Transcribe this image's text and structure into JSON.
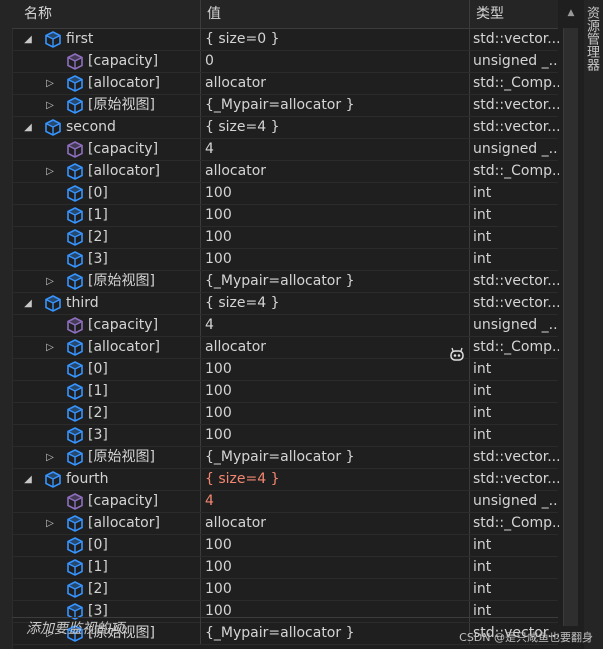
{
  "header": {
    "name": "名称",
    "value": "值",
    "type": "类型"
  },
  "right_rail": {
    "label": "资源管理器"
  },
  "add_watch": {
    "label": "添加要监视的项"
  },
  "watermark": {
    "text": "CSDN @是只咸鱼也要翻身"
  },
  "colors": {
    "changed_value": "#f48771",
    "cube_icon": "#3794ff",
    "capacity_icon": "#8e6fbf"
  },
  "rows": [
    {
      "level": 0,
      "expand": "expanded",
      "icon": "cube",
      "name": "first",
      "value": "{ size=0 }",
      "type": "std::vector...."
    },
    {
      "level": 1,
      "expand": "none",
      "icon": "capacity",
      "name": "[capacity]",
      "value": "0",
      "type": "unsigned _..."
    },
    {
      "level": 1,
      "expand": "collapsed",
      "icon": "cube",
      "name": "[allocator]",
      "value": "allocator",
      "type": "std::_Comp..."
    },
    {
      "level": 1,
      "expand": "collapsed",
      "icon": "cube",
      "name": "[原始视图]",
      "value": "{_Mypair=allocator }",
      "type": "std::vector...."
    },
    {
      "level": 0,
      "expand": "expanded",
      "icon": "cube",
      "name": "second",
      "value": "{ size=4 }",
      "type": "std::vector...."
    },
    {
      "level": 1,
      "expand": "none",
      "icon": "capacity",
      "name": "[capacity]",
      "value": "4",
      "type": "unsigned _..."
    },
    {
      "level": 1,
      "expand": "collapsed",
      "icon": "cube",
      "name": "[allocator]",
      "value": "allocator",
      "type": "std::_Comp..."
    },
    {
      "level": 1,
      "expand": "none",
      "icon": "cube",
      "name": "[0]",
      "value": "100",
      "type": "int"
    },
    {
      "level": 1,
      "expand": "none",
      "icon": "cube",
      "name": "[1]",
      "value": "100",
      "type": "int"
    },
    {
      "level": 1,
      "expand": "none",
      "icon": "cube",
      "name": "[2]",
      "value": "100",
      "type": "int"
    },
    {
      "level": 1,
      "expand": "none",
      "icon": "cube",
      "name": "[3]",
      "value": "100",
      "type": "int"
    },
    {
      "level": 1,
      "expand": "collapsed",
      "icon": "cube",
      "name": "[原始视图]",
      "value": "{_Mypair=allocator }",
      "type": "std::vector...."
    },
    {
      "level": 0,
      "expand": "expanded",
      "icon": "cube",
      "name": "third",
      "value": "{ size=4 }",
      "type": "std::vector...."
    },
    {
      "level": 1,
      "expand": "none",
      "icon": "capacity",
      "name": "[capacity]",
      "value": "4",
      "type": "unsigned _..."
    },
    {
      "level": 1,
      "expand": "collapsed",
      "icon": "cube",
      "name": "[allocator]",
      "value": "allocator",
      "type": "std::_Comp..."
    },
    {
      "level": 1,
      "expand": "none",
      "icon": "cube",
      "name": "[0]",
      "value": "100",
      "type": "int",
      "robot": true
    },
    {
      "level": 1,
      "expand": "none",
      "icon": "cube",
      "name": "[1]",
      "value": "100",
      "type": "int"
    },
    {
      "level": 1,
      "expand": "none",
      "icon": "cube",
      "name": "[2]",
      "value": "100",
      "type": "int"
    },
    {
      "level": 1,
      "expand": "none",
      "icon": "cube",
      "name": "[3]",
      "value": "100",
      "type": "int"
    },
    {
      "level": 1,
      "expand": "collapsed",
      "icon": "cube",
      "name": "[原始视图]",
      "value": "{_Mypair=allocator }",
      "type": "std::vector...."
    },
    {
      "level": 0,
      "expand": "expanded",
      "icon": "cube",
      "name": "fourth",
      "value": "{ size=4 }",
      "type": "std::vector....",
      "changed": true
    },
    {
      "level": 1,
      "expand": "none",
      "icon": "capacity",
      "name": "[capacity]",
      "value": "4",
      "type": "unsigned _...",
      "changed": true
    },
    {
      "level": 1,
      "expand": "collapsed",
      "icon": "cube",
      "name": "[allocator]",
      "value": "allocator",
      "type": "std::_Comp..."
    },
    {
      "level": 1,
      "expand": "none",
      "icon": "cube",
      "name": "[0]",
      "value": "100",
      "type": "int"
    },
    {
      "level": 1,
      "expand": "none",
      "icon": "cube",
      "name": "[1]",
      "value": "100",
      "type": "int"
    },
    {
      "level": 1,
      "expand": "none",
      "icon": "cube",
      "name": "[2]",
      "value": "100",
      "type": "int"
    },
    {
      "level": 1,
      "expand": "none",
      "icon": "cube",
      "name": "[3]",
      "value": "100",
      "type": "int"
    },
    {
      "level": 1,
      "expand": "collapsed",
      "icon": "cube",
      "name": "[原始视图]",
      "value": "{_Mypair=allocator }",
      "type": "std::vector...."
    }
  ]
}
